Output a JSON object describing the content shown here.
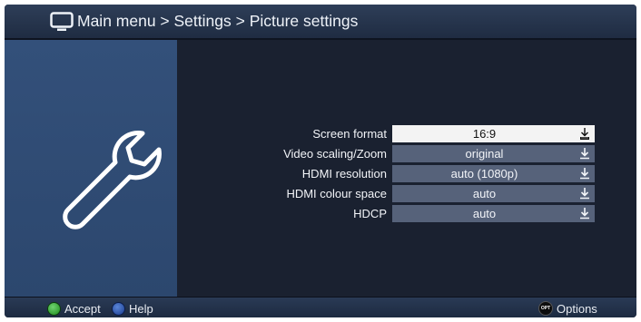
{
  "header": {
    "breadcrumb": "Main menu > Settings > Picture settings",
    "icon": "tv-icon"
  },
  "sidebar": {
    "icon": "wrench-icon"
  },
  "settings": [
    {
      "label": "Screen format",
      "value": "16:9",
      "selected": true
    },
    {
      "label": "Video scaling/Zoom",
      "value": "original",
      "selected": false
    },
    {
      "label": "HDMI resolution",
      "value": "auto (1080p)",
      "selected": false
    },
    {
      "label": "HDMI colour space",
      "value": "auto",
      "selected": false
    },
    {
      "label": "HDCP",
      "value": "auto",
      "selected": false
    }
  ],
  "footer": {
    "accept_label": "Accept",
    "help_label": "Help",
    "opt_badge": "OPT",
    "options_label": "Options"
  },
  "colors": {
    "accept_button": "#2e9e2e",
    "help_button": "#2a52b0",
    "selected_field": "#f3f3f3",
    "field": "#56627a"
  }
}
